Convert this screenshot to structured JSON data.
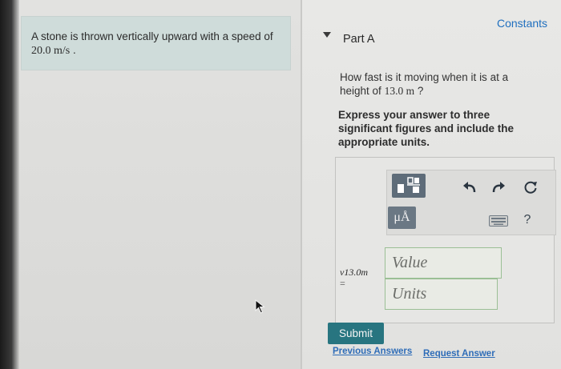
{
  "problem": {
    "text": "A stone is thrown vertically upward with a speed of",
    "speed": "20.0 m/s",
    "period": " ."
  },
  "header": {
    "constants_label": "Constants",
    "part_title": "Part A"
  },
  "question": {
    "text": "How fast is it moving when it is at a height of",
    "height": "13.0 m",
    "suffix": " ?"
  },
  "instruction": "Express your answer to three significant figures and include the appropriate units.",
  "answer": {
    "variable_label": "v13.0m",
    "equals": "=",
    "value_placeholder": "Value",
    "units_placeholder": "Units",
    "units_button_label": "μÅ",
    "help_label": "?"
  },
  "footer": {
    "submit_label": "Submit",
    "previous_answers_label": "Previous Answers",
    "request_answer_label": "Request Answer"
  },
  "icons": {
    "part_toggle": "triangle-down-icon",
    "template": "fraction-template-icon",
    "undo": "undo-icon",
    "redo": "redo-icon",
    "reset": "reset-icon",
    "keyboard": "keyboard-icon",
    "cursor": "mouse-cursor-icon"
  },
  "colors": {
    "problem_bg": "#cfdcda",
    "link": "#1f6fbf",
    "submit_bg": "#287580",
    "field_border": "#9bbf95",
    "toolbar_button": "#5e6c79"
  }
}
